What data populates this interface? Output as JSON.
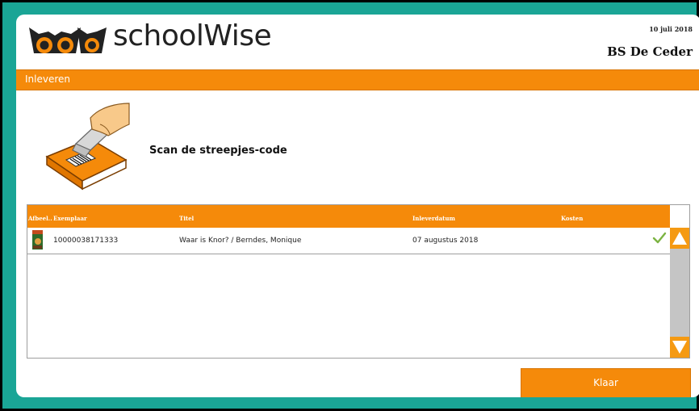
{
  "header": {
    "app_name": "schoolWise",
    "date": "10 juli 2018",
    "school": "BS De Ceder"
  },
  "section": {
    "title": "Inleveren"
  },
  "prompt": {
    "text": "Scan de streepjes-code"
  },
  "table": {
    "columns": [
      "Afbeel..",
      "Exemplaar",
      "Titel",
      "Inleverdatum",
      "Kosten"
    ],
    "rows": [
      {
        "copy": "10000038171333",
        "title": "Waar is Knor? / Berndes, Monique",
        "return_date": "07 augustus 2018",
        "cost": "",
        "status": "check-icon"
      }
    ]
  },
  "actions": {
    "done_label": "Klaar"
  },
  "colors": {
    "teal": "#1aa596",
    "orange": "#f58a0a",
    "check_green": "#7cb342",
    "scroll_track": "#c5c5c5"
  }
}
